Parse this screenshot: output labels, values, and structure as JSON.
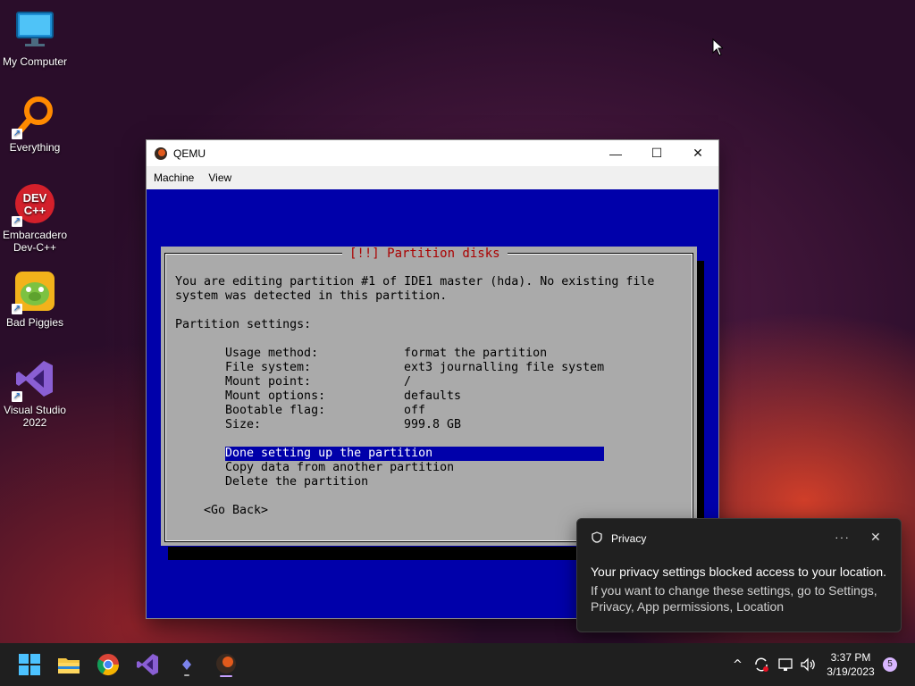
{
  "desktop": {
    "icons": [
      {
        "label": "My Computer"
      },
      {
        "label": "Everything"
      },
      {
        "label": "Embarcadero Dev-C++"
      },
      {
        "label": "Bad Piggies"
      },
      {
        "label": "Visual Studio 2022"
      }
    ]
  },
  "qemu": {
    "title": "QEMU",
    "menu": [
      "Machine",
      "View"
    ],
    "dialog": {
      "title": "[!!] Partition disks",
      "intro_line1": "You are editing partition #1 of IDE1 master (hda). No existing file",
      "intro_line2": "system was detected in this partition.",
      "settings_heading": "Partition settings:",
      "settings": [
        {
          "key": "Usage method:",
          "value": "format the partition"
        },
        {
          "key": "File system:",
          "value": "ext3 journalling file system"
        },
        {
          "key": "Mount point:",
          "value": "/"
        },
        {
          "key": "Mount options:",
          "value": "defaults"
        },
        {
          "key": "Bootable flag:",
          "value": "off"
        },
        {
          "key": "Size:",
          "value": "999.8 GB"
        }
      ],
      "actions": [
        "Done setting up the partition",
        "Copy data from another partition",
        "Delete the partition"
      ],
      "go_back": "<Go Back>"
    }
  },
  "notification": {
    "app": "Privacy",
    "message": "Your privacy settings blocked access to your location.",
    "detail": "If you want to change these settings, go to Settings, Privacy, App permissions, Location"
  },
  "taskbar": {
    "time": "3:37 PM",
    "date": "3/19/2023",
    "notification_count": "5"
  }
}
